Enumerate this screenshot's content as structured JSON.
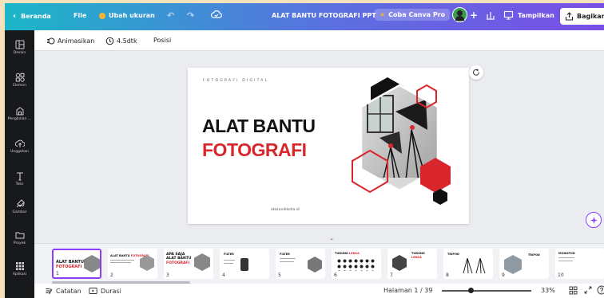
{
  "topbar": {
    "home": "Beranda",
    "file": "File",
    "resize": "Ubah ukuran",
    "doc_title": "ALAT BANTU FOTOGRAFI PPT",
    "try_pro": "Coba Canva Pro",
    "present": "Tampilkan",
    "share": "Bagikan"
  },
  "sidebar": {
    "items": [
      {
        "label": "Desain",
        "icon": "layout-icon"
      },
      {
        "label": "Elemen",
        "icon": "shapes-icon"
      },
      {
        "label": "Pengbalan ...",
        "icon": "brand-icon"
      },
      {
        "label": "Unggahan",
        "icon": "upload-icon"
      },
      {
        "label": "Teks",
        "icon": "text-icon"
      },
      {
        "label": "Gambar",
        "icon": "draw-icon"
      },
      {
        "label": "Proyek",
        "icon": "folder-icon"
      },
      {
        "label": "Aplikasi",
        "icon": "apps-icon"
      }
    ]
  },
  "toolbar": {
    "animate": "Animasikan",
    "duration": "4.5dtk",
    "position": "Posisi"
  },
  "slide": {
    "kicker": "FOTOGRAFI DIGITAL",
    "title_line1": "ALAT BANTU",
    "title_line2": "FOTOGRAFI",
    "website": "atozundikoha.id"
  },
  "thumbnails": [
    {
      "num": "1",
      "title": "ALAT BANTU",
      "subtitle": "FOTOGRAFI"
    },
    {
      "num": "2",
      "title": "ALAT BANTU",
      "subtitle": "FOTOGRAFI"
    },
    {
      "num": "3",
      "title": "APA SAJA ALAT BANTU",
      "subtitle": "FOTOGRAFI"
    },
    {
      "num": "4",
      "title": "FILTER",
      "subtitle": ""
    },
    {
      "num": "5",
      "title": "FILTER",
      "subtitle": ""
    },
    {
      "num": "6",
      "title": "TUDUNG",
      "subtitle": "LENSA"
    },
    {
      "num": "7",
      "title": "TUDUNG",
      "subtitle": "LENSA"
    },
    {
      "num": "8",
      "title": "TRIPOD",
      "subtitle": ""
    },
    {
      "num": "9",
      "title": "TRIPOD",
      "subtitle": ""
    },
    {
      "num": "10",
      "title": "MONOPOD",
      "subtitle": ""
    }
  ],
  "bottombar": {
    "notes": "Catatan",
    "duration": "Durasi",
    "page": "Halaman 1 / 39",
    "zoom": "33%",
    "zoom_level": 0.33
  },
  "colors": {
    "accent": "#d9262c",
    "topbar_start": "#1bb6c8",
    "topbar_end": "#7a4fe6",
    "pro_button": "#f3b234",
    "selected": "#8b3dff"
  }
}
